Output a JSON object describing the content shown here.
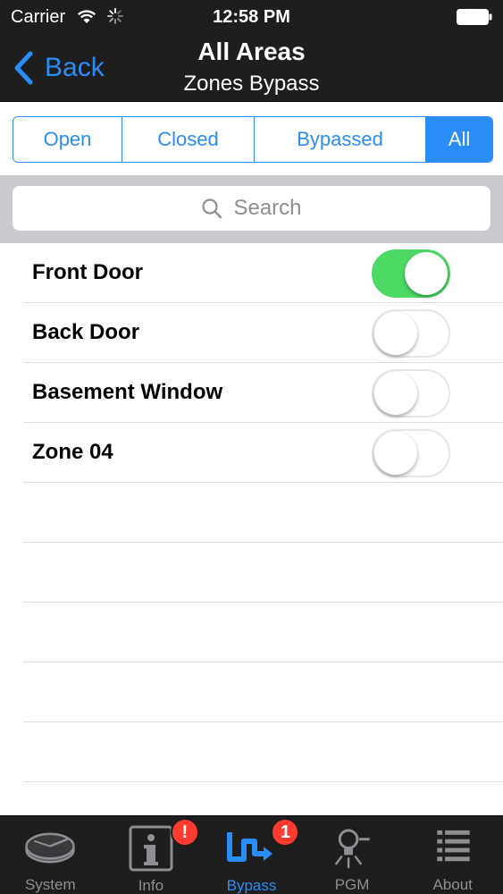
{
  "status_bar": {
    "carrier": "Carrier",
    "time": "12:58 PM"
  },
  "nav": {
    "back_label": "Back",
    "title": "All Areas",
    "subtitle": "Zones Bypass"
  },
  "filter": {
    "segments": [
      "Open",
      "Closed",
      "Bypassed",
      "All"
    ],
    "selected": "All"
  },
  "search": {
    "placeholder": "Search"
  },
  "zones": [
    {
      "name": "Front Door",
      "bypassed": true
    },
    {
      "name": "Back Door",
      "bypassed": false
    },
    {
      "name": "Basement Window",
      "bypassed": false
    },
    {
      "name": "Zone 04",
      "bypassed": false
    }
  ],
  "tabs": [
    {
      "label": "System",
      "icon": "system-disc-icon",
      "badge": ""
    },
    {
      "label": "Info",
      "icon": "info-icon",
      "badge": "!"
    },
    {
      "label": "Bypass",
      "icon": "bypass-arrow-icon",
      "badge": "1",
      "active": true
    },
    {
      "label": "PGM",
      "icon": "lightbulb-icon",
      "badge": ""
    },
    {
      "label": "About",
      "icon": "list-icon",
      "badge": ""
    }
  ],
  "colors": {
    "accent": "#2a8df7",
    "toggle_on": "#4cd964",
    "bar_background": "#1e1e1e",
    "badge": "#ff3b30"
  }
}
